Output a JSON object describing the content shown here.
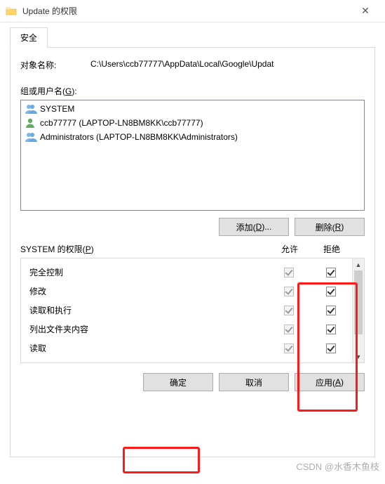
{
  "window": {
    "title": "Update 的权限",
    "close_glyph": "✕"
  },
  "tab": {
    "security": "安全"
  },
  "object": {
    "label": "对象名称:",
    "path": "C:\\Users\\ccb77777\\AppData\\Local\\Google\\Updat"
  },
  "groups": {
    "label_prefix": "组或用户名(",
    "label_u": "G",
    "label_suffix": "):",
    "items": [
      {
        "name": "SYSTEM",
        "type": "group"
      },
      {
        "name": "ccb77777 (LAPTOP-LN8BM8KK\\ccb77777)",
        "type": "user"
      },
      {
        "name": "Administrators (LAPTOP-LN8BM8KK\\Administrators)",
        "type": "group"
      }
    ]
  },
  "buttons": {
    "add_prefix": "添加(",
    "add_u": "D",
    "add_suffix": ")...",
    "remove_prefix": "删除(",
    "remove_u": "R",
    "remove_suffix": ")",
    "ok": "确定",
    "cancel": "取消",
    "apply_prefix": "应用(",
    "apply_u": "A",
    "apply_suffix": ")"
  },
  "perm_header": {
    "label_prefix": "SYSTEM 的权限(",
    "label_u": "P",
    "label_suffix": ")",
    "allow": "允许",
    "deny": "拒绝"
  },
  "permissions": [
    {
      "name": "完全控制",
      "allow": true,
      "deny": true
    },
    {
      "name": "修改",
      "allow": true,
      "deny": true
    },
    {
      "name": "读取和执行",
      "allow": true,
      "deny": true
    },
    {
      "name": "列出文件夹内容",
      "allow": true,
      "deny": true
    },
    {
      "name": "读取",
      "allow": true,
      "deny": true
    }
  ],
  "watermark": "CSDN @水香木鱼枝"
}
